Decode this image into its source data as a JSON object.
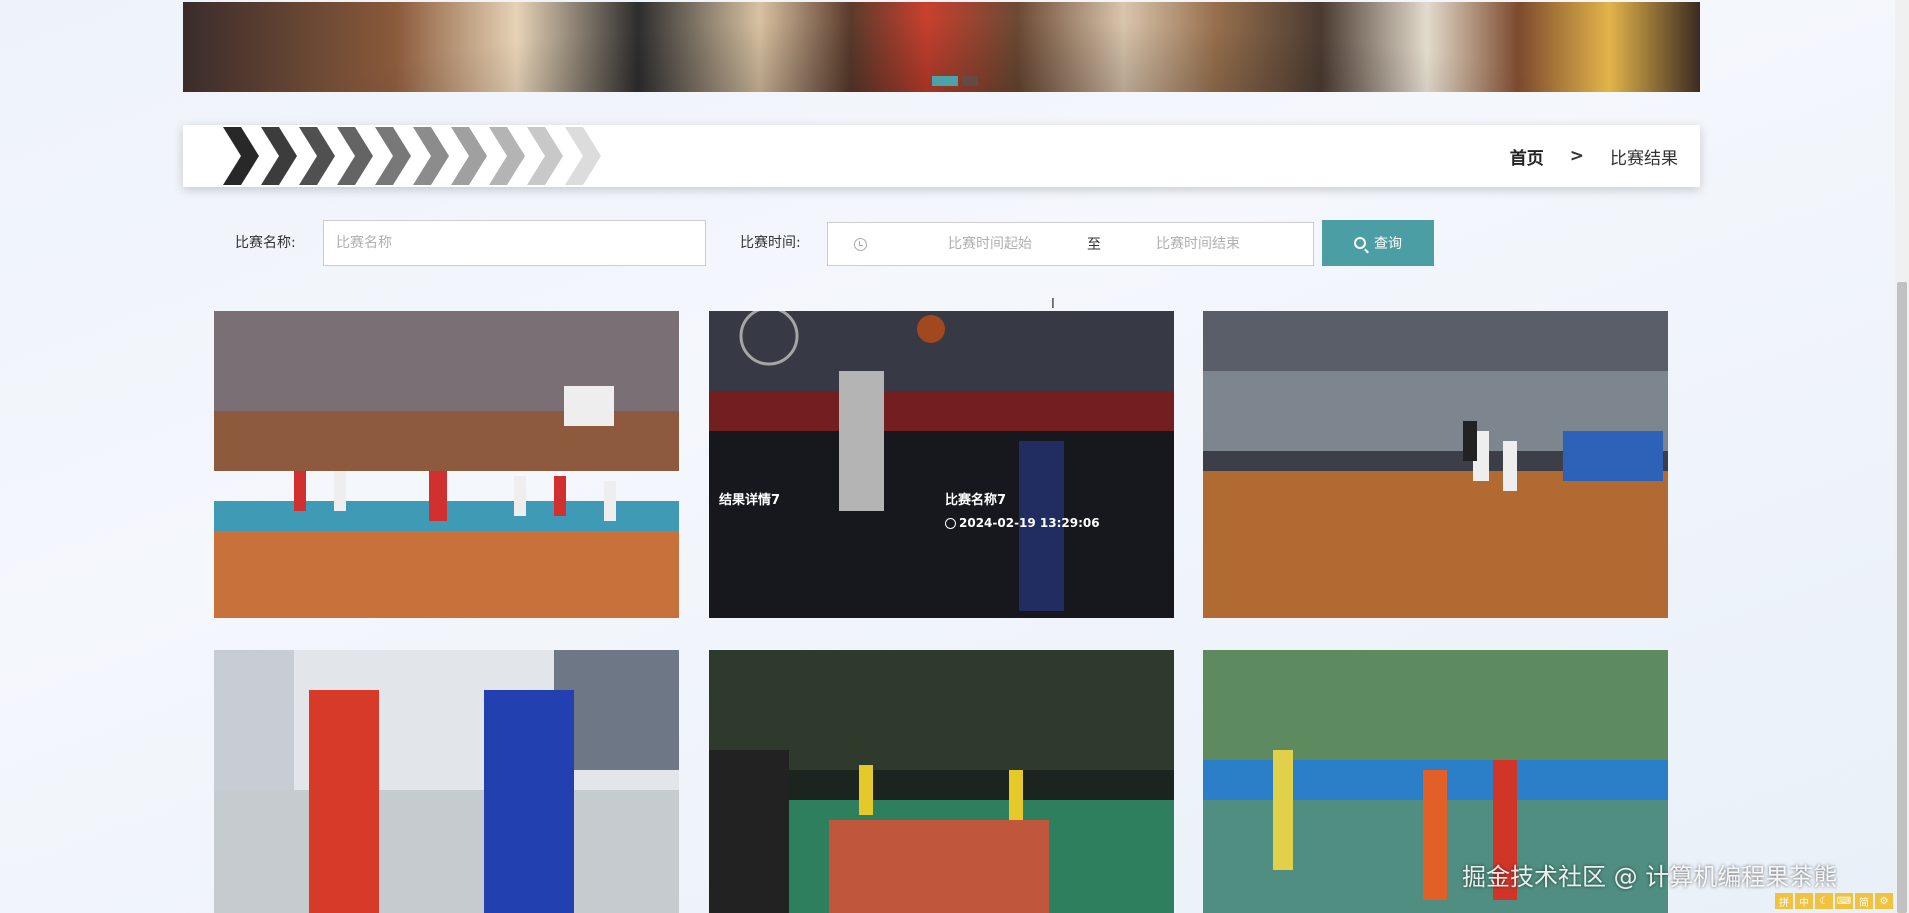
{
  "breadcrumb": {
    "home": "首页",
    "separator": ">",
    "current": "比赛结果"
  },
  "search": {
    "name_label": "比赛名称:",
    "name_placeholder": "比赛名称",
    "time_label": "比赛时间:",
    "time_start_placeholder": "比赛时间起始",
    "time_separator": "至",
    "time_end_placeholder": "比赛时间结束",
    "button_label": "查询"
  },
  "cards": [
    {
      "image": "basketball-game-indoor-red-team"
    },
    {
      "image": "basketball-slam-dunk",
      "detail": "结果详情7",
      "title": "比赛名称7",
      "time": "2024-02-19 13:29:06"
    },
    {
      "image": "basketball-arena-wood-floor"
    },
    {
      "image": "basketball-red-vs-blue-15"
    },
    {
      "image": "basketball-outdoor-night"
    },
    {
      "image": "basketball-outdoor-day"
    }
  ],
  "watermark": "掘金技术社区 @ 计算机编程果茶熊",
  "tray": [
    "拼",
    "中",
    "简"
  ],
  "colors": {
    "accent": "#4a9ea4",
    "background": "#eef3fa"
  }
}
